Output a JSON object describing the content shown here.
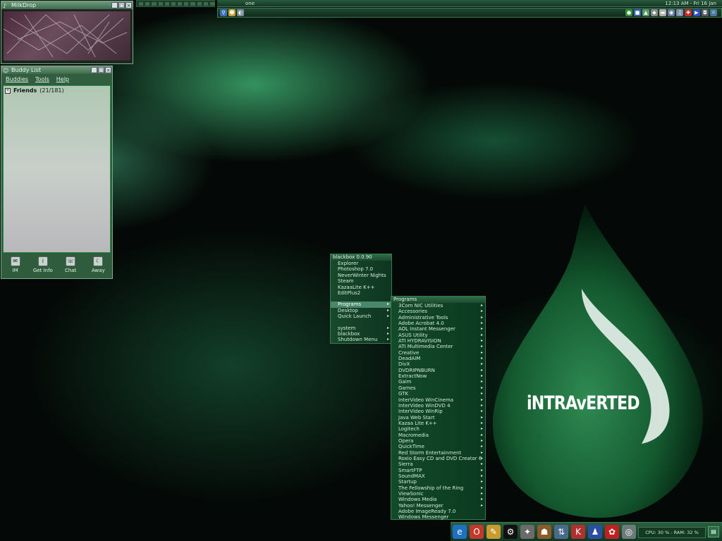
{
  "milkdrop": {
    "title": "MilkDrop"
  },
  "buddy_list": {
    "title": "Buddy List",
    "menu": [
      "Buddies",
      "Tools",
      "Help"
    ],
    "group": {
      "name": "Friends",
      "count": "(21/181)"
    },
    "toolbar": [
      "IM",
      "Get Info",
      "Chat",
      "Away"
    ]
  },
  "top_bar": {
    "workspace": "one",
    "clock": "12:13 AM - Fri 16 Jan"
  },
  "blackbox_menu": {
    "title": "blackbox 0.0.90",
    "items": [
      "Explorer",
      "Photoshop 7.0",
      "NeverWinter Nights",
      "Steam",
      "KazaaLite K++",
      "EditPlus2"
    ],
    "items2": [
      "Programs",
      "Desktop",
      "Quick Launch"
    ],
    "items3": [
      "system",
      "blackbox",
      "Shutdown Menu"
    ]
  },
  "programs_menu": {
    "title": "Programs",
    "items": [
      "3Com NIC Utilities",
      "Accessories",
      "Administrative Tools",
      "Adobe Acrobat 4.0",
      "AOL Instant Messenger",
      "ASUS Utility",
      "ATI HYDRAVISION",
      "ATI Multimedia Center",
      "Creative",
      "DeadAIM",
      "DivX",
      "DVDRIPNBURN",
      "ExtractNow",
      "Gaim",
      "Games",
      "GTK",
      "InterVideo WinCinema",
      "InterVideo WinDVD 4",
      "InterVideo WinRip",
      "Java Web Start",
      "Kazaa Lite K++",
      "Logitech",
      "Macromedia",
      "Opera",
      "QuickTime",
      "Red Storm Entertainment",
      "Roxio Easy CD and DVD Creator 6",
      "Sierra",
      "SmartFTP",
      "SoundMAX",
      "Startup",
      "The Fellowship of the Ring",
      "ViewSonic",
      "Windows Media",
      "Yahoo! Messenger",
      "Adobe ImageReady 7.0",
      "Windows Messenger"
    ],
    "submenu_count": 35
  },
  "logo": {
    "text": "iNTRAvERTED"
  },
  "tray": {
    "stats": "CPU: 30 % - RAM: 32 %"
  },
  "colors": {
    "accent": "#2f6e47",
    "highlight": "#49876a",
    "background": "#040806"
  }
}
